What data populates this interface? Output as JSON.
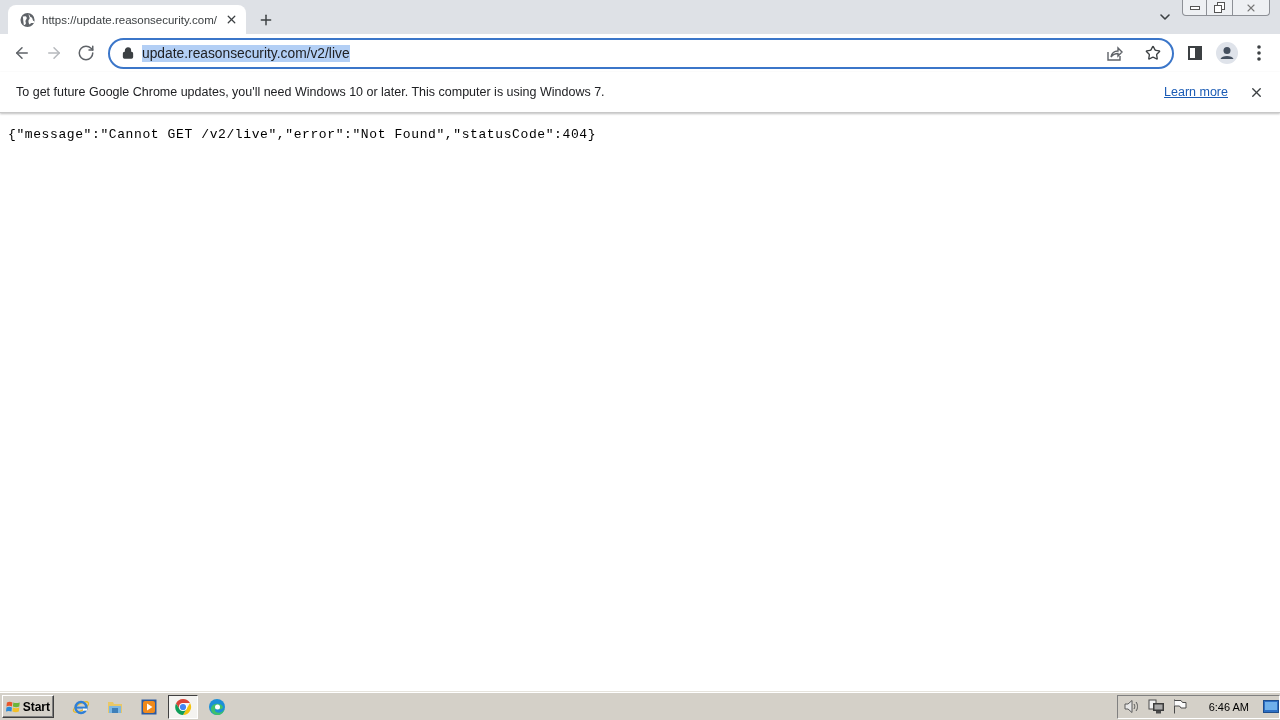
{
  "browser_tabs": [
    {
      "title": "https://update.reasonsecurity.com/",
      "selected": true
    }
  ],
  "nav_buttons": [
    {
      "kind": "back",
      "disabled": false
    },
    {
      "kind": "forward",
      "disabled": true
    },
    {
      "kind": "reload",
      "disabled": false
    }
  ],
  "address_bar": {
    "value": "update.reasonsecurity.com/v2/live",
    "selected": true
  },
  "infobar": {
    "message": "To get future Google Chrome updates, you'll need Windows 10 or later. This computer is using Windows 7.",
    "link": "Learn more"
  },
  "page": {
    "body": "{\"message\":\"Cannot GET /v2/live\",\"error\":\"Not Found\",\"statusCode\":404}"
  },
  "taskbar": {
    "start_label": "Start",
    "apps": [
      {
        "kind": "ie",
        "selected": false
      },
      {
        "kind": "explorer",
        "selected": false
      },
      {
        "kind": "media",
        "selected": false
      },
      {
        "kind": "chrome",
        "selected": true
      },
      {
        "kind": "edge",
        "selected": false
      }
    ],
    "clock": "6:46 AM"
  }
}
